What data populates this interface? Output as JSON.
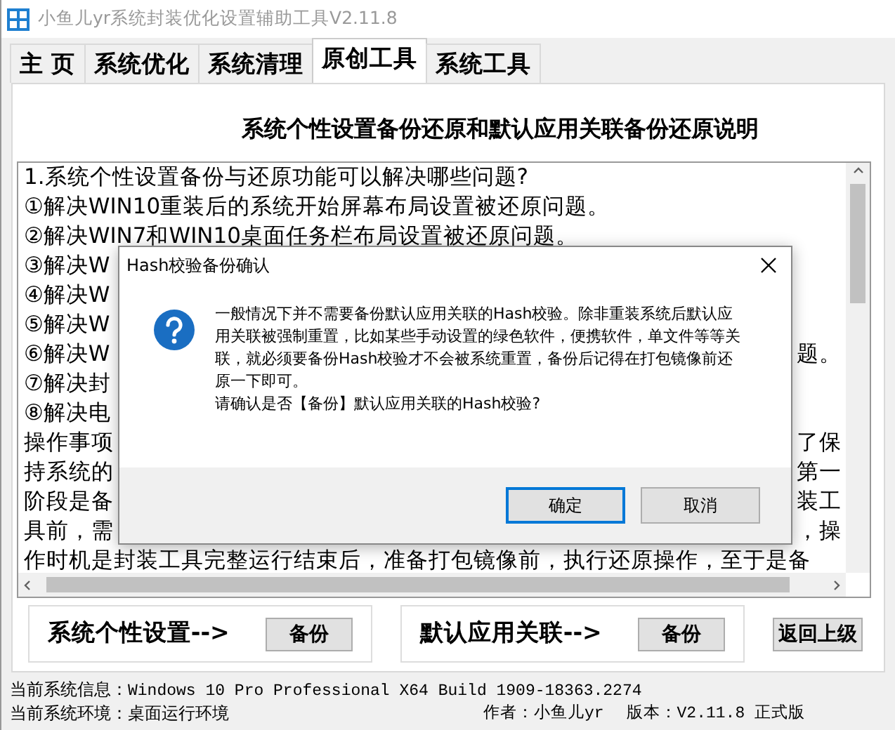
{
  "window": {
    "title": "小鱼儿yr系统封装优化设置辅助工具V2.11.8"
  },
  "tabs": [
    {
      "label": "主 页",
      "selected": false
    },
    {
      "label": "系统优化",
      "selected": false
    },
    {
      "label": "系统清理",
      "selected": false
    },
    {
      "label": "原创工具",
      "selected": true
    },
    {
      "label": "系统工具",
      "selected": false
    }
  ],
  "heading": "系统个性设置备份还原和默认应用关联备份还原说明",
  "text_box": {
    "lines": [
      {
        "left": "1.系统个性设置备份与还原功能可以解决哪些问题?"
      },
      {
        "left": "①解决WIN10重装后的系统开始屏幕布局设置被还原问题。"
      },
      {
        "left": "②解决WIN7和WIN10桌面任务栏布局设置被还原问题。"
      },
      {
        "left": "③解决W"
      },
      {
        "left": "④解决W"
      },
      {
        "left": "⑤解决W"
      },
      {
        "left": "⑥解决W",
        "right": "题。"
      },
      {
        "left": "⑦解决封"
      },
      {
        "left": "⑧解决电"
      },
      {
        "left": "操作事项",
        "right": "了保"
      },
      {
        "left": "持系统的",
        "right": "第一"
      },
      {
        "left": "阶段是备",
        "right": "装工"
      },
      {
        "left": "具前，需",
        "right": "，操"
      },
      {
        "left": "作时机是封装工具完整运行结束后，准备打包镜像前，执行还原操作，至于是备"
      }
    ]
  },
  "dialog": {
    "title": "Hash校验备份确认",
    "message": "一般情况下并不需要备份默认应用关联的Hash校验。除非重装系统后默认应用关联被强制重置，比如某些手动设置的绿色软件，便携软件，单文件等等关联，就必须要备份Hash校验才不会被系统重置，备份后记得在打包镜像前还原一下即可。",
    "question": "请确认是否【备份】默认应用关联的Hash校验?",
    "buttons": [
      {
        "label": "确定",
        "default": true
      },
      {
        "label": "取消",
        "default": false
      }
    ]
  },
  "actions": [
    {
      "label": "系统个性设置-->",
      "button": "备份"
    },
    {
      "label": "默认应用关联-->",
      "button": "备份"
    }
  ],
  "back_button": "返回上级",
  "status_bar": {
    "system_info_label": "当前系统信息：",
    "system_info": "Windows 10 Pro Professional X64 Build 1909-18363.2274",
    "environment_label": "当前系统环境：",
    "environment": "桌面运行环境",
    "author": "作者：小鱼儿yr",
    "version": "版本：V2.11.8 正式版"
  }
}
